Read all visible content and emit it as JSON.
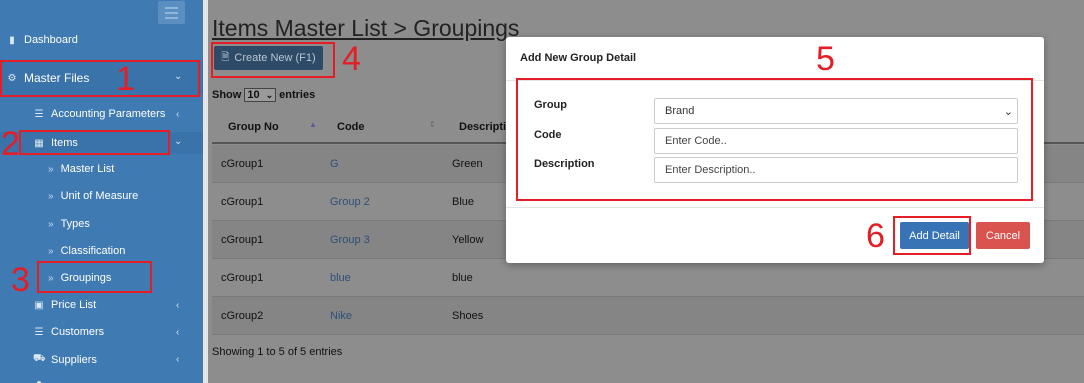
{
  "sidebar": {
    "items": [
      {
        "label": "Dashboard",
        "icon": "bar-chart-icon"
      },
      {
        "label": "Master Files",
        "icon": "gear-icon"
      },
      {
        "label": "Accounting Parameters",
        "icon": "list-icon"
      },
      {
        "label": "Items",
        "icon": "grid-icon"
      },
      {
        "label": "Master List"
      },
      {
        "label": "Unit of Measure"
      },
      {
        "label": "Types"
      },
      {
        "label": "Classification"
      },
      {
        "label": "Groupings"
      },
      {
        "label": "Price List",
        "icon": "money-icon"
      },
      {
        "label": "Customers",
        "icon": "list-icon"
      },
      {
        "label": "Suppliers",
        "icon": "truck-icon"
      }
    ]
  },
  "page": {
    "title": "Items Master List > Groupings",
    "create_label": "Create New (F1)",
    "show_label": "Show",
    "entries_value": "10",
    "entries_label": "entries",
    "footer": "Showing 1 to 5 of 5 entries"
  },
  "table": {
    "headers": [
      "Group No",
      "Code",
      "Descriptio"
    ],
    "rows": [
      [
        "cGroup1",
        "G",
        "Green"
      ],
      [
        "cGroup1",
        "Group 2",
        "Blue"
      ],
      [
        "cGroup1",
        "Group 3",
        "Yellow"
      ],
      [
        "cGroup1",
        "blue",
        "blue"
      ],
      [
        "cGroup2",
        "Nike",
        "Shoes"
      ]
    ]
  },
  "modal": {
    "title": "Add New Group Detail",
    "group_label": "Group",
    "group_value": "Brand",
    "code_label": "Code",
    "code_placeholder": "Enter Code..",
    "description_label": "Description",
    "description_placeholder": "Enter Description..",
    "add_label": "Add Detail",
    "cancel_label": "Cancel"
  },
  "annotations": [
    "1",
    "2",
    "3",
    "4",
    "5",
    "6"
  ],
  "colors": {
    "sidebar": "#3f7ab3",
    "annotation": "#e41e26",
    "primary": "#3773b5",
    "danger": "#d9534f"
  }
}
